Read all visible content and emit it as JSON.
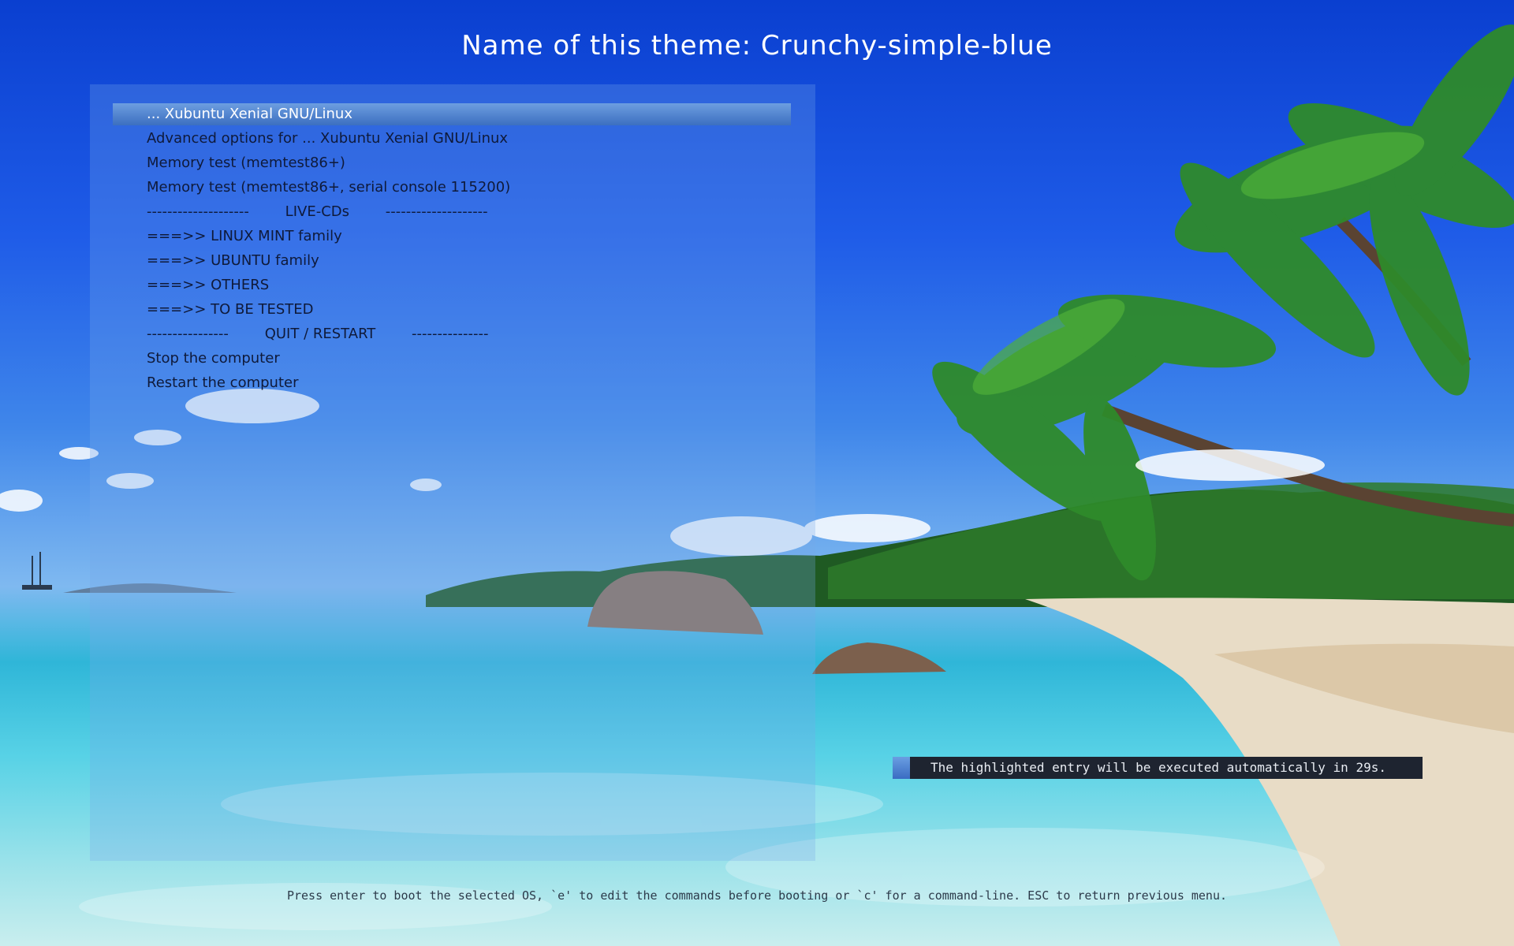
{
  "theme": {
    "title": "Name of this theme: Crunchy-simple-blue",
    "accent": "#3c6fc0"
  },
  "menu": {
    "items": [
      {
        "label": "... Xubuntu Xenial GNU/Linux",
        "selected": true
      },
      {
        "label": "Advanced options for ... Xubuntu Xenial GNU/Linux"
      },
      {
        "label": "Memory test (memtest86+)"
      },
      {
        "label": "Memory test (memtest86+, serial console 115200)"
      },
      {
        "label": "--------------------        LIVE-CDs        --------------------"
      },
      {
        "label": "===>> LINUX MINT family"
      },
      {
        "label": "===>> UBUNTU family"
      },
      {
        "label": "===>> OTHERS"
      },
      {
        "label": "===>> TO BE TESTED"
      },
      {
        "label": "----------------        QUIT / RESTART        ---------------"
      },
      {
        "label": "Stop the computer"
      },
      {
        "label": "Restart the computer"
      }
    ]
  },
  "countdown": {
    "text": "The highlighted entry will be executed automatically in 29s."
  },
  "help": {
    "text": "Press enter to boot the selected OS, `e' to edit the commands before booting or `c' for a command-line. ESC to return previous menu."
  }
}
